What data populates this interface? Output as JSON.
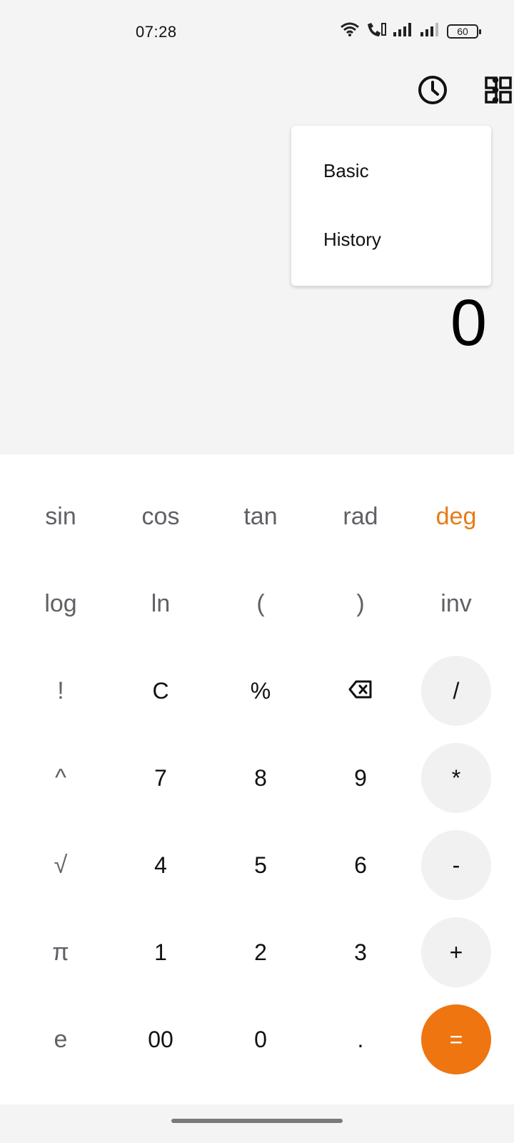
{
  "status_bar": {
    "time": "07:28",
    "battery": "60"
  },
  "menu": {
    "items": [
      "Basic",
      "History"
    ]
  },
  "display": {
    "value": "0"
  },
  "keys": {
    "r1": [
      "sin",
      "cos",
      "tan",
      "rad",
      "deg"
    ],
    "r2": [
      "log",
      "ln",
      "(",
      ")",
      "inv"
    ],
    "r3": [
      "!",
      "C",
      "%",
      "",
      "/"
    ],
    "r4": [
      "^",
      "7",
      "8",
      "9",
      "*"
    ],
    "r5": [
      "√",
      "4",
      "5",
      "6",
      "-"
    ],
    "r6": [
      "π",
      "1",
      "2",
      "3",
      "+"
    ],
    "r7": [
      "e",
      "00",
      "0",
      ".",
      "="
    ]
  },
  "colors": {
    "accent": "#ee7510",
    "deg_text": "#e67b16",
    "operator_bg": "#f1f1f1"
  },
  "icons": [
    "wifi-icon",
    "wifi-calling-icon",
    "signal-icon",
    "battery-icon",
    "history-icon",
    "grid-icon",
    "more-vert-icon",
    "backspace-icon"
  ]
}
